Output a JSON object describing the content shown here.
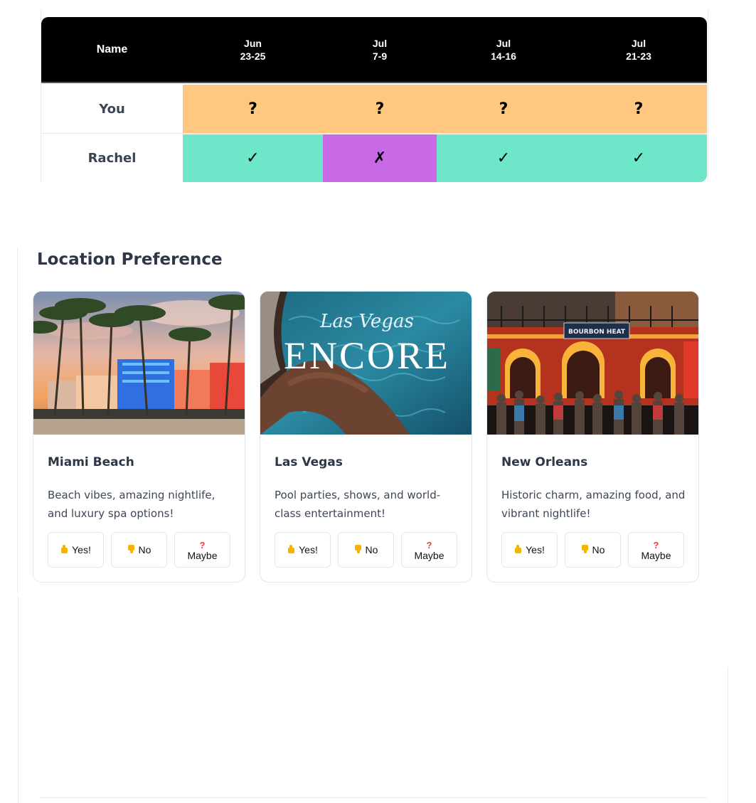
{
  "availability": {
    "header_name": "Name",
    "dates": [
      {
        "month": "Jun",
        "days": "23-25"
      },
      {
        "month": "Jul",
        "days": "7-9"
      },
      {
        "month": "Jul",
        "days": "14-16"
      },
      {
        "month": "Jul",
        "days": "21-23"
      }
    ],
    "rows": [
      {
        "name": "You",
        "marks": [
          "?",
          "?",
          "?",
          "?"
        ],
        "colors": [
          "#ffc77f",
          "#ffc77f",
          "#ffc77f",
          "#ffc77f"
        ]
      },
      {
        "name": "Rachel",
        "marks": [
          "✓",
          "✗",
          "✓",
          "✓"
        ],
        "colors": [
          "#6ee6c9",
          "#c86ae6",
          "#6ee6c9",
          "#6ee6c9"
        ]
      }
    ]
  },
  "location": {
    "title": "Location Preference",
    "cards": [
      {
        "name": "Miami Beach",
        "description": "Beach vibes, amazing nightlife, and luxury spa options!",
        "image": "miami-beach-photo"
      },
      {
        "name": "Las Vegas",
        "description": "Pool parties, shows, and world-class entertainment!",
        "image": "las-vegas-encore-photo",
        "image_text_script": "Las Vegas",
        "image_text_main": "ENCORE"
      },
      {
        "name": "New Orleans",
        "description": "Historic charm, amazing food, and vibrant nightlife!",
        "image": "new-orleans-bourbon-street-photo",
        "image_text_sign": "BOURBON HEAT"
      }
    ],
    "buttons": {
      "yes": "Yes!",
      "no": "No",
      "maybe": "Maybe",
      "maybe_icon": "?"
    }
  }
}
